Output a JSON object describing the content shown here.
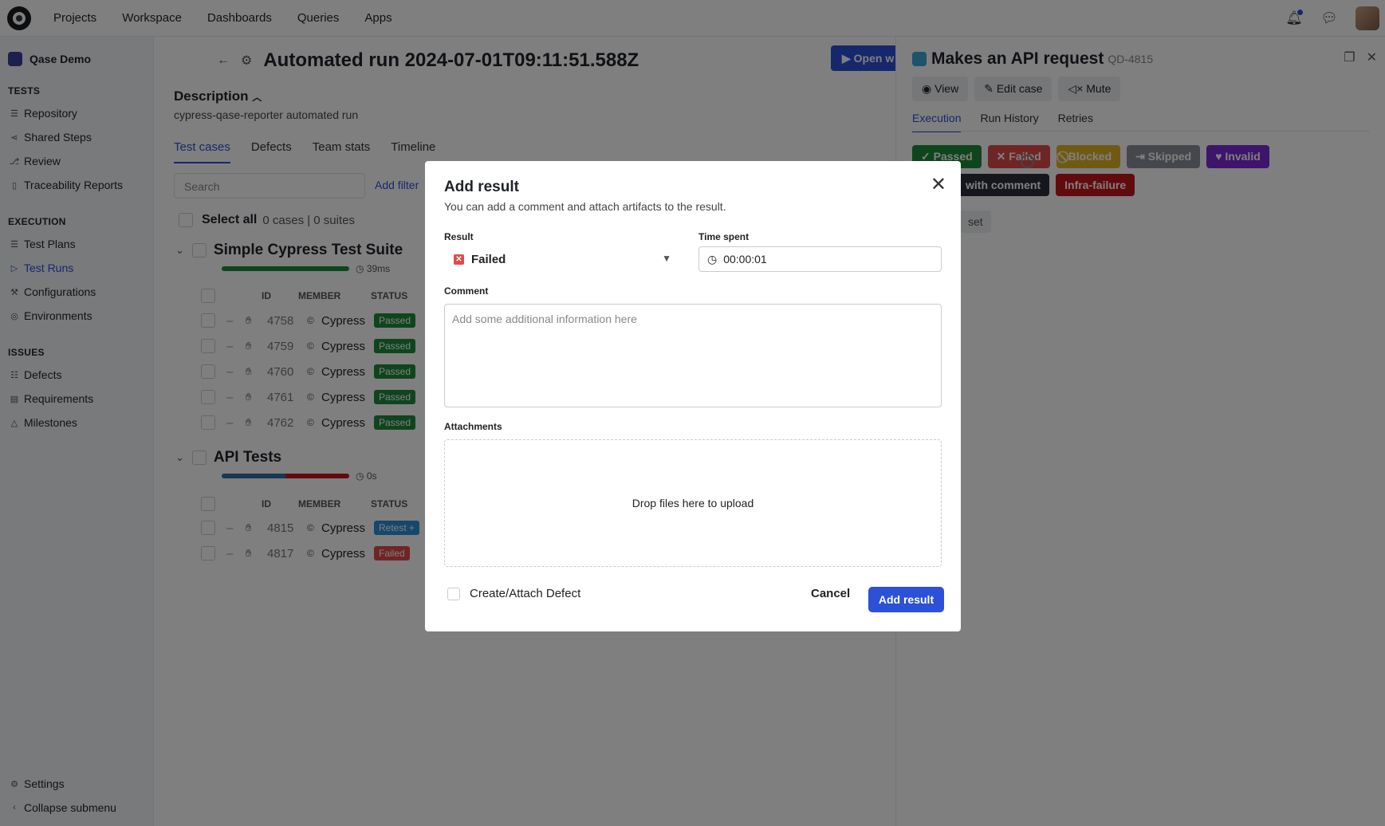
{
  "nav": [
    "Projects",
    "Workspace",
    "Dashboards",
    "Queries",
    "Apps"
  ],
  "sidebar": {
    "project": "Qase Demo",
    "tests_title": "TESTS",
    "tests": [
      "Repository",
      "Shared Steps",
      "Review",
      "Traceability Reports"
    ],
    "execution_title": "EXECUTION",
    "execution": [
      "Test Plans",
      "Test Runs",
      "Configurations",
      "Environments"
    ],
    "issues_title": "ISSUES",
    "issues": [
      "Defects",
      "Requirements",
      "Milestones"
    ],
    "settings": "Settings",
    "collapse": "Collapse submenu"
  },
  "main": {
    "title": "Automated run 2024-07-01T09:11:51.588Z",
    "open_button": "Open w",
    "description_title": "Description",
    "description": "cypress-qase-reporter automated run",
    "tabs": [
      "Test cases",
      "Defects",
      "Team stats",
      "Timeline"
    ],
    "search_placeholder": "Search",
    "add_filter": "Add filter",
    "select_all": "Select all",
    "counts": "0 cases | 0 suites",
    "columns": {
      "id": "ID",
      "member": "MEMBER",
      "status": "STATUS"
    },
    "suites": [
      {
        "name": "Simple Cypress Test Suite",
        "time": "39ms",
        "rows": [
          {
            "id": "4758",
            "member": "Cypress",
            "status": "Passed"
          },
          {
            "id": "4759",
            "member": "Cypress",
            "status": "Passed"
          },
          {
            "id": "4760",
            "member": "Cypress",
            "status": "Passed"
          },
          {
            "id": "4761",
            "member": "Cypress",
            "status": "Passed"
          },
          {
            "id": "4762",
            "member": "Cypress",
            "status": "Passed"
          }
        ]
      },
      {
        "name": "API Tests",
        "time": "0s",
        "rows": [
          {
            "id": "4815",
            "member": "Cypress",
            "status": "Retest +"
          },
          {
            "id": "4817",
            "member": "Cypress",
            "status": "Failed"
          }
        ]
      }
    ]
  },
  "panel": {
    "title": "Makes an API request",
    "case_id": "QD-4815",
    "actions": [
      "View",
      "Edit case",
      "Mute"
    ],
    "tabs": [
      "Execution",
      "Run History",
      "Retries"
    ],
    "results_row1": [
      {
        "label": "Passed",
        "icon": "✓",
        "color": "#1f8a3a"
      },
      {
        "label": "Failed",
        "icon": "✕",
        "color": "#e14a4a"
      },
      {
        "label": "Blocked",
        "icon": "⃠",
        "color": "#e0b526"
      },
      {
        "label": "Skipped",
        "icon": "⇥",
        "color": "#8a8f99"
      },
      {
        "label": "Invalid",
        "icon": "♥",
        "color": "#7a2bd6"
      }
    ],
    "results_row2": [
      {
        "label": "with comment",
        "color": "#2b2f3a"
      },
      {
        "label": "Infra-failure",
        "color": "#c4161c"
      }
    ],
    "reset": "set"
  },
  "modal": {
    "title": "Add result",
    "subtitle": "You can add a comment and attach artifacts to the result.",
    "result_label": "Result",
    "result_value": "Failed",
    "time_label": "Time spent",
    "time_value": "00:00:01",
    "comment_label": "Comment",
    "comment_placeholder": "Add some additional information here",
    "attachments_label": "Attachments",
    "drop_text": "Drop files here to upload",
    "defect_label": "Create/Attach Defect",
    "cancel": "Cancel",
    "submit": "Add result"
  },
  "colors": {
    "accent": "#2d50d9",
    "passed": "#1f8a3a",
    "failed": "#e14a4a"
  }
}
